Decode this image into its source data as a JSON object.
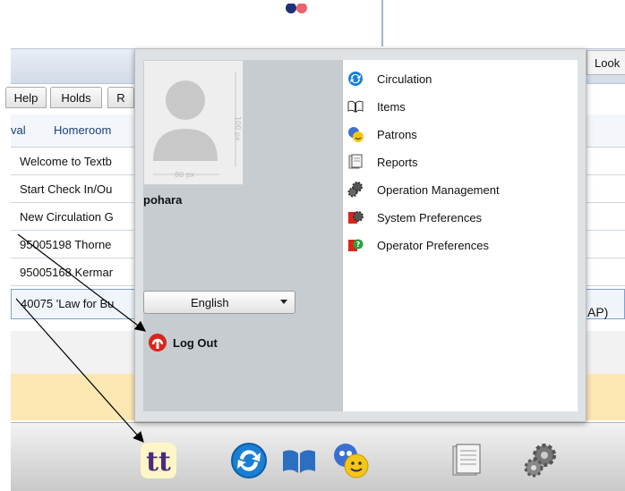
{
  "header": {
    "look_label": "Look"
  },
  "tabs": [
    {
      "label": "Help"
    },
    {
      "label": "Holds"
    },
    {
      "label": "R"
    }
  ],
  "subnav": [
    {
      "label": "val"
    },
    {
      "label": "Homeroom"
    }
  ],
  "rows": [
    {
      "text": "Welcome to Textb"
    },
    {
      "text": "Start Check In/Ou"
    },
    {
      "text": "New Circulation G"
    },
    {
      "text": "95005198 Thorne"
    },
    {
      "text": "95005168 Kermar"
    },
    {
      "text": "40075 'Law for Bu"
    }
  ],
  "row_tail": "AP)",
  "user_menu": {
    "photo_width_label": "80 px",
    "photo_height_label": "100 px",
    "username": "pohara",
    "language": "English",
    "logout_label": "Log Out"
  },
  "menu_items": [
    {
      "label": "Circulation",
      "icon": "circulation-icon"
    },
    {
      "label": "Items",
      "icon": "items-icon"
    },
    {
      "label": "Patrons",
      "icon": "patrons-icon"
    },
    {
      "label": "Reports",
      "icon": "reports-icon"
    },
    {
      "label": "Operation Management",
      "icon": "operation-management-icon"
    },
    {
      "label": "System Preferences",
      "icon": "system-preferences-icon"
    },
    {
      "label": "Operator Preferences",
      "icon": "operator-preferences-icon"
    }
  ],
  "dock_items": [
    {
      "icon": "textbook-tracker-logo"
    },
    {
      "icon": "circulation-icon"
    },
    {
      "icon": "items-icon"
    },
    {
      "icon": "patrons-icon"
    },
    {
      "icon": "reports-icon"
    },
    {
      "icon": "operation-management-icon"
    }
  ],
  "colors": {
    "accent_blue": "#1a7fd4",
    "logout_red": "#d9251c",
    "brand_purple": "#4b2a7b"
  }
}
